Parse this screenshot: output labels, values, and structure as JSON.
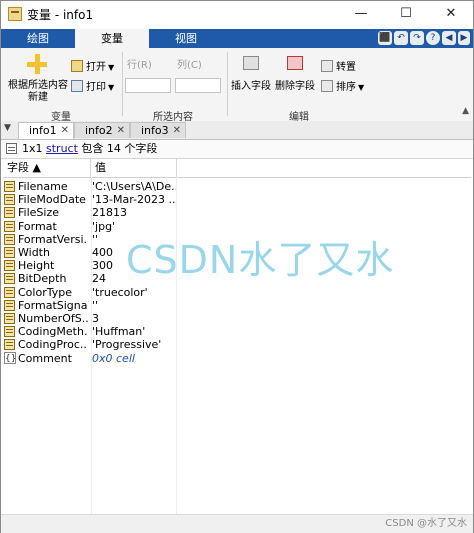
{
  "window": {
    "title": "变量 - info1"
  },
  "window_controls": {
    "minimize": "—",
    "maximize": "☐",
    "close": "✕"
  },
  "ribbon_tabs": [
    {
      "label": "绘图"
    },
    {
      "label": "变量"
    },
    {
      "label": "视图"
    }
  ],
  "quick_access": [
    "⬛",
    "↶",
    "↷",
    "?",
    "◀",
    "▶"
  ],
  "ribbon": {
    "new_from_selection": "根据所选内容\n新建",
    "open": "打开",
    "print": "打印",
    "row": "行(R)",
    "col": "列(C)",
    "insert_field": "插入字段",
    "delete_field": "删除字段",
    "transpose": "转置",
    "sort": "排序",
    "group_variable": "变量",
    "group_selection": "所选内容",
    "group_edit": "编辑"
  },
  "doc_tabs": [
    {
      "label": "info1"
    },
    {
      "label": "info2"
    },
    {
      "label": "info3"
    }
  ],
  "info_line": {
    "prefix": "1x1",
    "link": "struct",
    "suffix": "包含 14 个字段"
  },
  "table": {
    "headers": {
      "field": "字段 ▲",
      "value": "值"
    },
    "rows": [
      {
        "name": "Filename",
        "value": "'C:\\Users\\A\\De...",
        "icon": "field-icon"
      },
      {
        "name": "FileModDate",
        "value": "'13-Mar-2023 ...",
        "icon": "field-icon"
      },
      {
        "name": "FileSize",
        "value": "21813",
        "icon": "field-icon"
      },
      {
        "name": "Format",
        "value": "'jpg'",
        "icon": "field-icon"
      },
      {
        "name": "FormatVersi...",
        "value": "''",
        "icon": "field-icon"
      },
      {
        "name": "Width",
        "value": "400",
        "icon": "field-icon"
      },
      {
        "name": "Height",
        "value": "300",
        "icon": "field-icon"
      },
      {
        "name": "BitDepth",
        "value": "24",
        "icon": "field-icon"
      },
      {
        "name": "ColorType",
        "value": "'truecolor'",
        "icon": "field-icon"
      },
      {
        "name": "FormatSigna...",
        "value": "''",
        "icon": "field-icon"
      },
      {
        "name": "NumberOfS...",
        "value": "3",
        "icon": "field-icon"
      },
      {
        "name": "CodingMeth...",
        "value": "'Huffman'",
        "icon": "field-icon"
      },
      {
        "name": "CodingProc...",
        "value": "'Progressive'",
        "icon": "field-icon"
      },
      {
        "name": "Comment",
        "value": "0x0 cell",
        "icon": "cell-icon"
      }
    ]
  },
  "watermark": {
    "text": "CSDN水了又水",
    "corner": "CSDN @水了又水"
  },
  "colors": {
    "tab_bar": "#1e5aa8",
    "watermark": "#78c8e1",
    "link": "#1c1ca8"
  }
}
